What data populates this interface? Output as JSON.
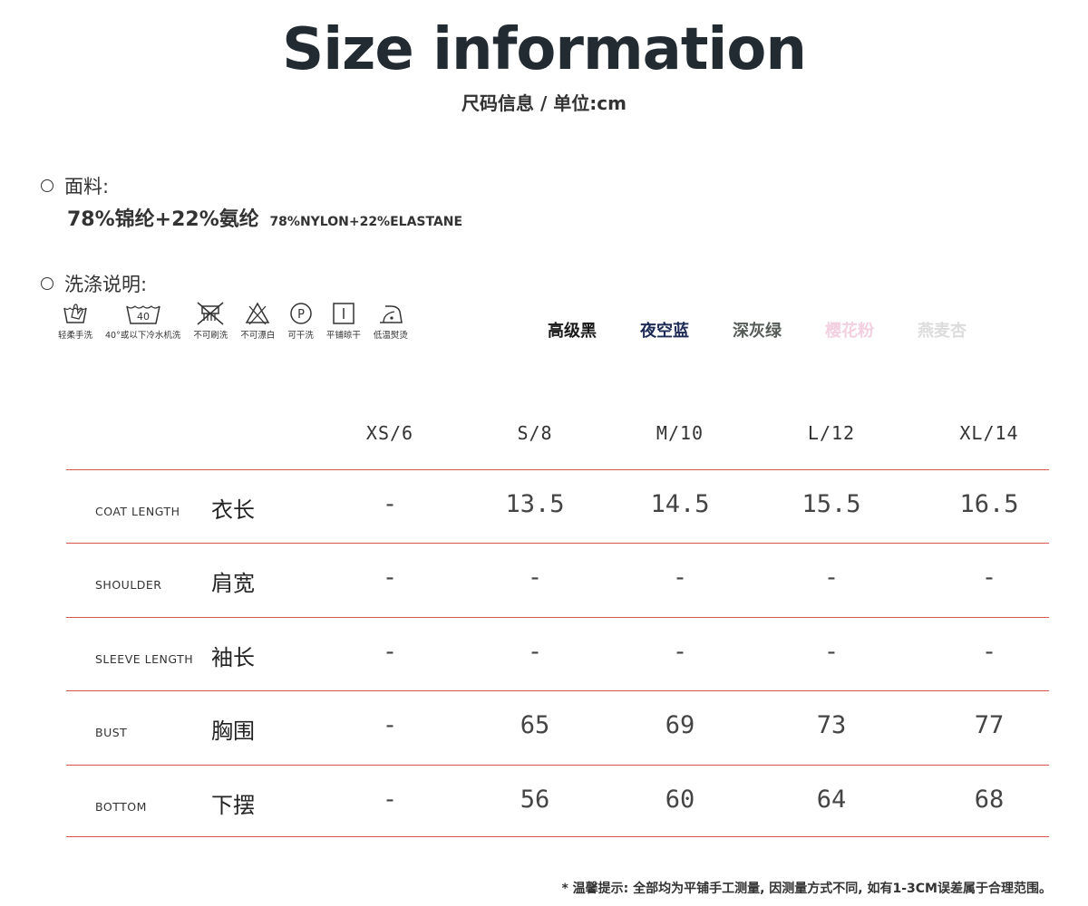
{
  "header": {
    "title": "Size information",
    "subtitle": "尺码信息 / 单位:cm"
  },
  "fabric": {
    "heading": "面料:",
    "content_cn": "78%锦纶+22%氨纶",
    "content_en": "78%NYLON+22%ELASTANE"
  },
  "care": {
    "heading": "洗涤说明:",
    "items": [
      {
        "icon": "hand-wash-icon",
        "label": "轻柔手洗"
      },
      {
        "icon": "machine-wash-40-icon",
        "label": "40°或以下冷水机洗",
        "badge": "40"
      },
      {
        "icon": "no-brush-icon",
        "label": "不可刷洗"
      },
      {
        "icon": "no-bleach-icon",
        "label": "不可漂白"
      },
      {
        "icon": "dry-clean-p-icon",
        "label": "可干洗",
        "badge": "P"
      },
      {
        "icon": "flat-dry-icon",
        "label": "平铺晾干"
      },
      {
        "icon": "low-iron-icon",
        "label": "低温熨烫"
      }
    ]
  },
  "colors": [
    {
      "name": "高级黑",
      "color": "#1a1a1a"
    },
    {
      "name": "夜空蓝",
      "color": "#1c2a55"
    },
    {
      "name": "深灰绿",
      "color": "#555b56"
    },
    {
      "name": "樱花粉",
      "color": "#f3cfe0"
    },
    {
      "name": "燕麦杏",
      "color": "#dcdcdc"
    }
  ],
  "table": {
    "sizes": [
      "XS/6",
      "S/8",
      "M/10",
      "L/12",
      "XL/14"
    ],
    "rows": [
      {
        "en": "COAT LENGTH",
        "cn": "衣长",
        "values": [
          "-",
          "13.5",
          "14.5",
          "15.5",
          "16.5"
        ]
      },
      {
        "en": "SHOULDER",
        "cn": "肩宽",
        "values": [
          "-",
          "-",
          "-",
          "-",
          "-"
        ]
      },
      {
        "en": "SLEEVE LENGTH",
        "cn": "袖长",
        "values": [
          "-",
          "-",
          "-",
          "-",
          "-"
        ]
      },
      {
        "en": "BUST",
        "cn": "胸围",
        "values": [
          "-",
          "65",
          "69",
          "73",
          "77"
        ]
      },
      {
        "en": "BOTTOM",
        "cn": "下摆",
        "values": [
          "-",
          "56",
          "60",
          "64",
          "68"
        ]
      }
    ]
  },
  "note": "* 温馨提示: 全部均为平铺手工测量, 因测量方式不同, 如有1-3CM误差属于合理范围。",
  "accent_line_color": "#d9534f"
}
